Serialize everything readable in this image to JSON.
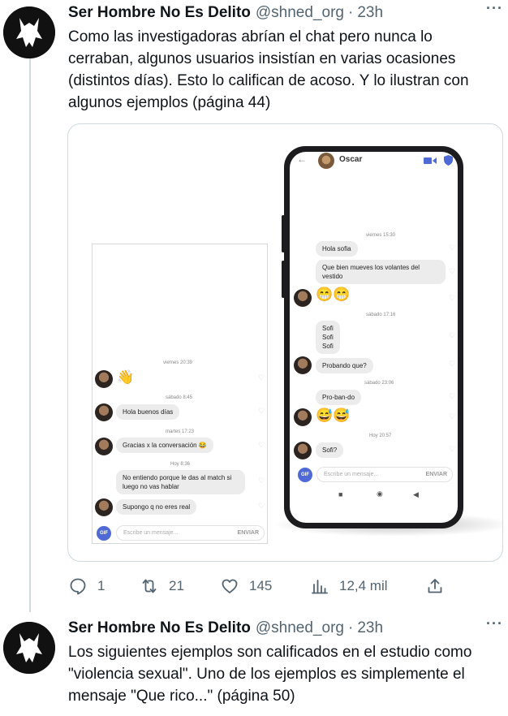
{
  "tweets": [
    {
      "name": "Ser Hombre No Es Delito",
      "handle": "@shned_org",
      "separator": "·",
      "time": "23h",
      "more": "···",
      "text": "Como las investigadoras abrían el chat pero nunca lo cerraban, algunos usuarios insistían en varias ocasiones (distintos días). Esto lo califican de acoso. Y lo ilustran con algunos ejemplos (página 44)",
      "actions": {
        "replies": "1",
        "retweets": "21",
        "likes": "145",
        "views": "12,4 mil"
      }
    },
    {
      "name": "Ser Hombre No Es Delito",
      "handle": "@shned_org",
      "separator": "·",
      "time": "23h",
      "more": "···",
      "text": "Los siguientes ejemplos son calificados en el estudio como \"violencia sexual\". Uno de los ejemplos es simplemente el mensaje \"Que rico...\" (página 50)"
    }
  ],
  "left_chat": {
    "stamp1": "viernes 20:39",
    "emoji1": "👋",
    "stamp2": "sábado 8:45",
    "msg1": "Hola buenos días",
    "stamp3": "martes 17:23",
    "msg2": "Gracias x la conversación 😂",
    "stamp4": "Hoy 8:36",
    "msg3": "No entiendo porque le das al match si luego no vas hablar",
    "msg4": "Supongo q no eres real",
    "gif": "GIF",
    "placeholder": "Escribe un mensaje...",
    "send": "ENVIAR"
  },
  "phone_chat": {
    "back": "←",
    "contact": "Oscar",
    "stamp1": "viernes 15:30",
    "msg1": "Hola sofia",
    "msg2": "Que bien mueves los volantes del vestido",
    "emoji1": "😁😁",
    "stamp2": "sábado 17:16",
    "msg3": "Sofi Sofi Sofi",
    "msg4": "Probando que?",
    "stamp3": "sábado 23:06",
    "msg5": "Pro-ban-do",
    "emoji2": "😅😅",
    "stamp4": "Hoy 20:57",
    "msg6": "Sofi?",
    "gif": "GIF",
    "placeholder": "Escribe un mensaje...",
    "send": "ENVIAR",
    "nav_square": "■",
    "nav_circle": "◉",
    "nav_back": "◀"
  },
  "colors": {
    "accent_blue": "#4f6ad6",
    "text_secondary": "#536471",
    "border": "#cfd9de"
  }
}
